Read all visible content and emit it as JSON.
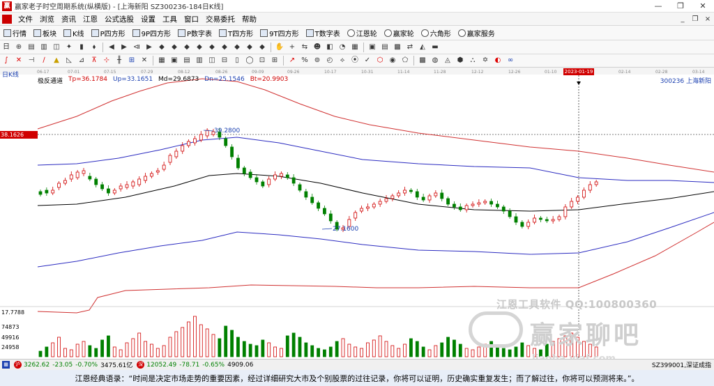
{
  "window": {
    "title": "赢家老子时空周期系统(纵横版) - [上海新阳  SZ300236-184日K线]",
    "minimize_glyph": "—",
    "restore_glyph": "❐",
    "close_glyph": "✕"
  },
  "menu": {
    "items": [
      "文件",
      "浏览",
      "资讯",
      "江恩",
      "公式选股",
      "设置",
      "工具",
      "窗口",
      "交易委托",
      "帮助"
    ],
    "mdi": [
      "_",
      "❐",
      "×"
    ]
  },
  "toolbar1": {
    "items": [
      "行情",
      "板块",
      "K线",
      "P四方形",
      "9P四方形",
      "P数字表",
      "T四方形",
      "9T四方形",
      "T数字表",
      "江恩轮",
      "赢家轮",
      "六角形",
      "赢家服务"
    ]
  },
  "toolbar2": {
    "tools": [
      "日",
      "⊕",
      "▤",
      "▥",
      "◫",
      "✦",
      "▮",
      "⬧",
      "◀",
      "▶",
      "⧏",
      "▶",
      "◆",
      "◆",
      "◆",
      "◆",
      "◆",
      "◆",
      "◆",
      "◆",
      "◆",
      "✋",
      "+",
      "⇆",
      "☻",
      "◧",
      "◔",
      "▦",
      "▣",
      "▤",
      "▩",
      "⇄",
      "◭",
      "▬"
    ]
  },
  "toolbar3": {
    "tools": [
      {
        "g": "∫",
        "c": "red"
      },
      {
        "g": "✕",
        "c": "red"
      },
      {
        "g": "⊣",
        "c": ""
      },
      {
        "g": "∕",
        "c": "red"
      },
      {
        "g": "▲",
        "c": "yellow"
      },
      {
        "g": "◺",
        "c": ""
      },
      {
        "g": "⊿",
        "c": ""
      },
      {
        "g": "⊼",
        "c": "red"
      },
      {
        "g": "⊹",
        "c": "red"
      },
      {
        "g": "╫",
        "c": ""
      },
      {
        "g": "⊞",
        "c": "blue"
      },
      {
        "g": "✕",
        "c": ""
      },
      {
        "g": "▦",
        "c": ""
      },
      {
        "g": "▣",
        "c": ""
      },
      {
        "g": "▤",
        "c": ""
      },
      {
        "g": "▥",
        "c": ""
      },
      {
        "g": "◫",
        "c": ""
      },
      {
        "g": "⊟",
        "c": ""
      },
      {
        "g": "▯",
        "c": ""
      },
      {
        "g": "◯",
        "c": ""
      },
      {
        "g": "⊡",
        "c": ""
      },
      {
        "g": "⊞",
        "c": ""
      },
      {
        "g": "↗",
        "c": "red"
      },
      {
        "g": "%",
        "c": ""
      },
      {
        "g": "⊚",
        "c": ""
      },
      {
        "g": "◴",
        "c": ""
      },
      {
        "g": "⟡",
        "c": ""
      },
      {
        "g": "⦿",
        "c": ""
      },
      {
        "g": "✓",
        "c": ""
      },
      {
        "g": "⬡",
        "c": "red"
      },
      {
        "g": "◉",
        "c": ""
      },
      {
        "g": "⬠",
        "c": ""
      },
      {
        "g": "▩",
        "c": ""
      },
      {
        "g": "◍",
        "c": ""
      },
      {
        "g": "◬",
        "c": ""
      },
      {
        "g": "⬢",
        "c": ""
      },
      {
        "g": "⛬",
        "c": ""
      },
      {
        "g": "✡",
        "c": ""
      },
      {
        "g": "◐",
        "c": "red"
      },
      {
        "g": "∞",
        "c": "blue"
      }
    ]
  },
  "chart": {
    "period": "日K线",
    "indicator": {
      "name": "极反通道",
      "tp": "Tp=36.1784",
      "up": "Up=33.1651",
      "md": "Md=29.6873",
      "dn": "Dn=25.1546",
      "bt": "Bt=20.9903"
    },
    "stock": "300236  上海新阳",
    "price_tag": "38.1626",
    "cursor_date": "2023-01-19",
    "high_annotation": "39.2800",
    "low_annotation": "27.1600",
    "dates": [
      "06-17",
      "07-01",
      "07-15",
      "07-29",
      "08-12",
      "08-26",
      "09-09",
      "09-26",
      "10-17",
      "10-31",
      "11-14",
      "11-28",
      "12-12",
      "12-26",
      "01-10",
      "2023-01-19",
      "02-14",
      "02-28",
      "03-14"
    ],
    "price_label_low": "17.7788",
    "volume_labels": [
      "74873",
      "49916",
      "24958"
    ]
  },
  "watermark": {
    "line1": "江恩工具软件   QQ:100800360",
    "line2": "赢家聊吧",
    "line3": "liaoba.yiaf.com"
  },
  "statusbar": {
    "idx1": "3262.62",
    "chg1": "-23.05",
    "pct1": "-0.70%",
    "amt1": "3475.61亿",
    "idx2": "12052.49",
    "chg2": "-78.71",
    "pct2": "-0.65%",
    "amt2": "4909.06",
    "right": "SZ399001,深证成指"
  },
  "quote": "江恩经典语录：“时间是决定市场走势的重要因素，经过详细研究大市及个别股票的过往记录，你将可以证明，历史确实重复发生；而了解过往，你将可以预测将来。”。"
}
